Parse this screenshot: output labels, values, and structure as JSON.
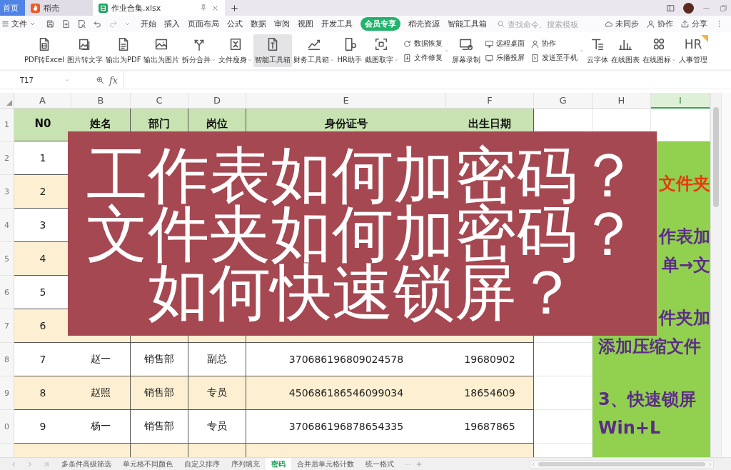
{
  "title_bar": {
    "tabs": [
      {
        "kind": "home",
        "label": "首页",
        "selected": false
      },
      {
        "kind": "docer",
        "label": "稻壳",
        "selected": false
      },
      {
        "kind": "sheet",
        "label": "作业合集.xlsx",
        "selected": true
      }
    ]
  },
  "menu_bar": {
    "file_label": "文件",
    "tabs": [
      {
        "label": "开始",
        "selected": false
      },
      {
        "label": "插入",
        "selected": false
      },
      {
        "label": "页面布局",
        "selected": false
      },
      {
        "label": "公式",
        "selected": false
      },
      {
        "label": "数据",
        "selected": false
      },
      {
        "label": "审阅",
        "selected": false
      },
      {
        "label": "视图",
        "selected": false
      },
      {
        "label": "开发工具",
        "selected": false
      },
      {
        "label": "会员专享",
        "selected": true
      },
      {
        "label": "稻壳资源",
        "selected": false
      },
      {
        "label": "智能工具箱",
        "selected": false
      }
    ],
    "search": {
      "placeholder": "查找命令、搜索模板"
    },
    "actions": [
      "未同步",
      "协作",
      "分享"
    ]
  },
  "ribbon": {
    "items": [
      {
        "kind": "large",
        "label": "PDF转Excel",
        "highlighted": false,
        "has_menu": false
      },
      {
        "kind": "large",
        "label": "图片转文字",
        "highlighted": false,
        "has_menu": false
      },
      {
        "kind": "large",
        "label": "输出为PDF",
        "highlighted": false,
        "has_menu": false
      },
      {
        "kind": "large",
        "label": "输出为图片",
        "highlighted": false,
        "has_menu": false
      },
      {
        "kind": "large",
        "label": "拆分合并",
        "highlighted": false,
        "has_menu": true
      },
      {
        "kind": "large",
        "label": "文件瘦身",
        "highlighted": false,
        "has_menu": true
      },
      {
        "kind": "large",
        "label": "智能工具箱",
        "highlighted": true,
        "has_menu": false
      },
      {
        "kind": "large",
        "label": "财务工具箱",
        "highlighted": false,
        "has_menu": true
      },
      {
        "kind": "large",
        "label": "HR助手",
        "highlighted": false,
        "has_menu": false
      },
      {
        "kind": "large",
        "label": "截图取字",
        "highlighted": false,
        "has_menu": true
      },
      {
        "kind": "stack",
        "entries": [
          {
            "label": "数据恢复",
            "highlighted": false
          },
          {
            "label": "文件修复",
            "highlighted": false
          }
        ],
        "has_menu": true
      },
      {
        "kind": "large",
        "label": "屏幕录制",
        "highlighted": false,
        "has_menu": false
      },
      {
        "kind": "stack",
        "entries": [
          {
            "label": "远程桌面",
            "highlighted": false
          },
          {
            "label": "乐播投屏",
            "highlighted": false
          }
        ],
        "has_menu": false
      },
      {
        "kind": "stack",
        "entries": [
          {
            "label": "协作",
            "highlighted": false
          },
          {
            "label": "发送至手机",
            "highlighted": false
          }
        ],
        "has_menu": true
      },
      {
        "kind": "large",
        "label": "云字体",
        "highlighted": false,
        "has_menu": false
      },
      {
        "kind": "large",
        "label": "在线图表",
        "highlighted": false,
        "has_menu": false
      },
      {
        "kind": "large",
        "label": "在线图标",
        "highlighted": false,
        "has_menu": true
      },
      {
        "kind": "large",
        "label": "人事管理",
        "highlighted": false,
        "has_menu": false,
        "icon_text": "HR"
      }
    ]
  },
  "formula_bar": {
    "name_box": "T17",
    "function_label": "fx"
  },
  "sheet": {
    "columns": [
      {
        "label": "A",
        "selected": false
      },
      {
        "label": "B",
        "selected": false
      },
      {
        "label": "C",
        "selected": false
      },
      {
        "label": "D",
        "selected": false
      },
      {
        "label": "E",
        "selected": false
      },
      {
        "label": "F",
        "selected": false
      },
      {
        "label": "G",
        "selected": false
      },
      {
        "label": "H",
        "selected": false
      },
      {
        "label": "I",
        "selected": true
      }
    ],
    "row_numbers": [
      "1",
      "2",
      "3",
      "4",
      "5",
      "6",
      "7",
      "8",
      "9",
      "0"
    ],
    "header": [
      "N0",
      "姓名",
      "部门",
      "岗位",
      "身份证号",
      "出生日期"
    ],
    "rows": [
      [
        "1"
      ],
      [
        "2"
      ],
      [
        "3"
      ],
      [
        "4"
      ],
      [
        "5"
      ],
      [
        "6"
      ],
      [
        "7",
        "赵一",
        "销售部",
        "副总",
        "370686196809024578",
        "19680902"
      ],
      [
        "8",
        "赵照",
        "销售部",
        "专员",
        "450686186546099034",
        "18654609"
      ],
      [
        "9",
        "杨一",
        "销售部",
        "专员",
        "370686196878654335",
        "19687865"
      ]
    ],
    "note_panel": {
      "paragraphs": [
        {
          "lines": [
            {
              "kind": "fragment",
              "text": "文件夹",
              "color": "#e8380d"
            }
          ]
        },
        {
          "lines": [
            {
              "kind": "fragment",
              "text": "作表加",
              "color": "#5b2d86"
            },
            {
              "kind": "fragment",
              "text": "单→文",
              "color": "#5b2d86"
            }
          ]
        },
        {
          "lines": [
            {
              "kind": "fragment",
              "text": "件夹加",
              "color": "#5b2d86"
            },
            {
              "kind": "line",
              "text": "添加压缩文件",
              "color": "#5b2d86"
            }
          ]
        },
        {
          "lines": [
            {
              "kind": "line",
              "text": "3、快速锁屏",
              "color": "#5b2d86"
            },
            {
              "kind": "line",
              "text": "Win+L",
              "color": "#5b2d86"
            }
          ]
        }
      ]
    }
  },
  "overlay": {
    "lines": [
      "工作表如何加密码？",
      "文件夹如何加密码？",
      "如何快速锁屏？"
    ]
  },
  "sheet_tabs": {
    "tabs": [
      {
        "label": "多条件高级筛选",
        "selected": false
      },
      {
        "label": "单元格不同颜色",
        "selected": false
      },
      {
        "label": "自定义排序",
        "selected": false
      },
      {
        "label": "序列填充",
        "selected": false
      },
      {
        "label": "密码",
        "selected": true
      },
      {
        "label": "合并后单元格计数",
        "selected": false
      },
      {
        "label": "统一格式",
        "selected": false
      }
    ]
  }
}
